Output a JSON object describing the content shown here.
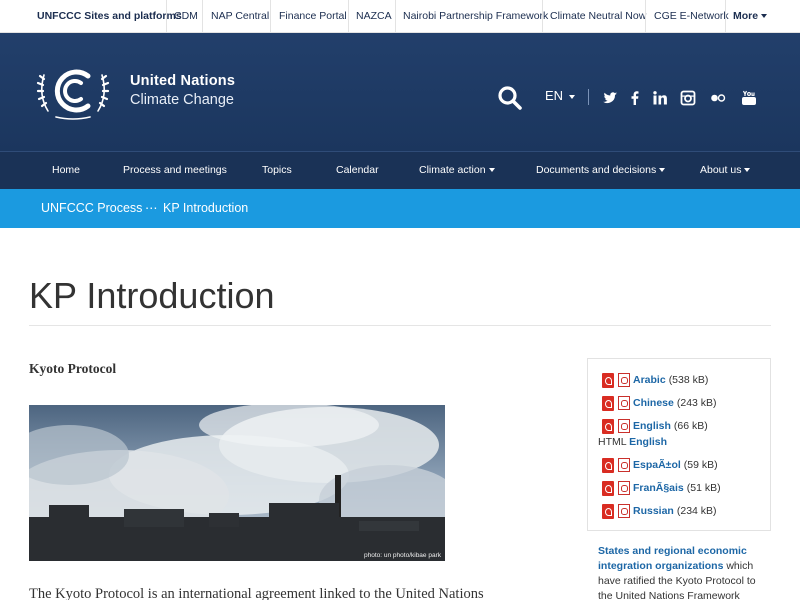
{
  "topbar": {
    "items": [
      "UNFCCC Sites and platforms",
      "CDM",
      "NAP Central",
      "Finance Portal",
      "NAZCA",
      "Nairobi Partnership Framework",
      "Climate Neutral Now",
      "CGE E-Network",
      "More"
    ]
  },
  "header": {
    "brand_line1": "United Nations",
    "brand_line2": "Climate Change",
    "language": "EN",
    "icons": [
      "search-icon",
      "twitter-icon",
      "facebook-icon",
      "linkedin-icon",
      "instagram-icon",
      "flickr-icon",
      "youtube-icon"
    ]
  },
  "mainnav": {
    "items": [
      "Home",
      "Process and meetings",
      "Topics",
      "Calendar",
      "Climate action",
      "Documents and decisions",
      "About us"
    ]
  },
  "breadcrumb": {
    "parent": "UNFCCC Process",
    "separator": "⋯",
    "current": "KP Introduction"
  },
  "page": {
    "title": "KP Introduction",
    "section_heading": "Kyoto Protocol",
    "photo_credit": "photo: un photo/kibae park",
    "intro_text": "The Kyoto Protocol is an international agreement linked to the United Nations"
  },
  "sidebar": {
    "downloads": [
      {
        "label": "Arabic",
        "size": "(538 kB)"
      },
      {
        "label": "Chinese",
        "size": "(243 kB)"
      },
      {
        "label": "English",
        "size": "(66 kB)"
      },
      {
        "label": "EspaÃ±ol",
        "size": "(59 kB)"
      },
      {
        "label": "FranÃ§ais",
        "size": "(51 kB)"
      },
      {
        "label": "Russian",
        "size": "(234 kB)"
      }
    ],
    "html_prefix": "HTML",
    "html_link": "English",
    "ratified_link": "States and regional economic integration organizations",
    "ratified_text": "which have ratified the Kyoto Protocol to the United Nations Framework"
  },
  "colors": {
    "header_bg": "#1f3a63",
    "nav_bg": "#1a3256",
    "breadcrumb_bg": "#1b9ae0",
    "link": "#1d67a6",
    "pdf_red": "#d92c22"
  }
}
